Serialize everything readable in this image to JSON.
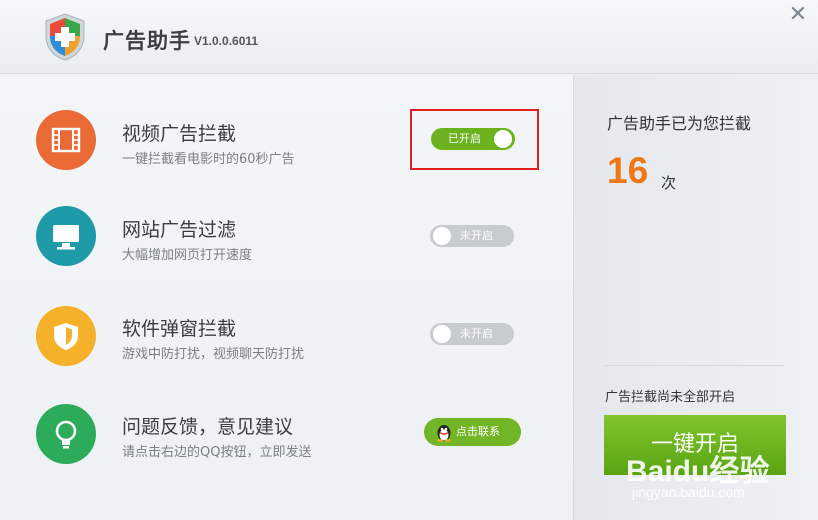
{
  "header": {
    "title": "广告助手",
    "version": "V1.0.0.6011",
    "close_icon": "close-icon"
  },
  "features": [
    {
      "icon": "film-icon",
      "color": "#ea6a35",
      "title": "视频广告拦截",
      "desc": "一键拦截看电影时的60秒广告",
      "status": "已开启",
      "enabled": true
    },
    {
      "icon": "monitor-icon",
      "color": "#1e9aa8",
      "title": "网站广告过滤",
      "desc": "大幅增加网页打开速度",
      "status": "未开启",
      "enabled": false
    },
    {
      "icon": "shield-icon",
      "color": "#f5b12a",
      "title": "软件弹窗拦截",
      "desc": "游戏中防打扰，视频聊天防打扰",
      "status": "未开启",
      "enabled": false
    },
    {
      "icon": "lightbulb-icon",
      "color": "#2cab5a",
      "title": "问题反馈，意见建议",
      "desc": "请点击右边的QQ按钮，立即发送",
      "button": "点击联系"
    }
  ],
  "side": {
    "title": "广告助手已为您拦截",
    "count": "16",
    "unit": "次",
    "note": "广告拦截尚未全部开启",
    "action": "一键开启"
  },
  "watermark": {
    "logo": "Baidu经验",
    "url": "jingyan.baidu.com"
  }
}
